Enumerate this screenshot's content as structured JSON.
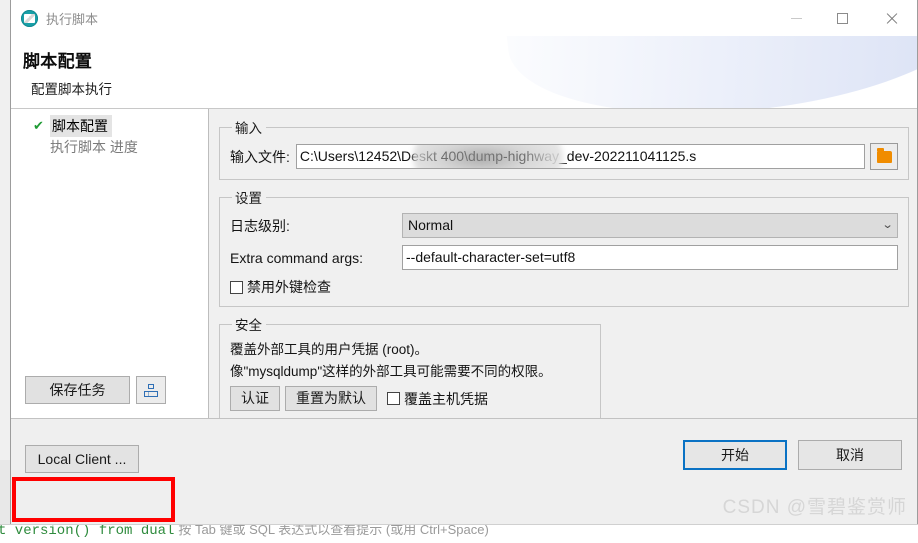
{
  "window": {
    "title": "执行脚本",
    "icon": "app-icon",
    "controls": {
      "minimize": "minimize-icon",
      "maximize": "maximize-icon",
      "close": "close-icon"
    }
  },
  "header": {
    "title": "脚本配置",
    "subtitle": "配置脚本执行"
  },
  "sidebar": {
    "items": [
      {
        "label": "脚本配置",
        "check": "✔",
        "selected": true
      },
      {
        "label": "执行脚本 进度",
        "selected": false
      }
    ],
    "save_task_label": "保存任务",
    "save_icon": "save-disk-icon"
  },
  "input_group": {
    "legend": "输入",
    "file_label": "输入文件:",
    "file_value": "C:\\Users\\12452\\Deskt                    400\\dump-highway_dev-202211041125.s",
    "browse_icon": "folder-icon"
  },
  "settings_group": {
    "legend": "设置",
    "log_level_label": "日志级别:",
    "log_level_value": "Normal",
    "log_level_chevron": "⌄",
    "extra_args_label": "Extra command args:",
    "extra_args_value": "--default-character-set=utf8",
    "disable_fk_label": "禁用外键检查",
    "disable_fk_checked": false
  },
  "security_group": {
    "legend": "安全",
    "line1": "覆盖外部工具的用户凭据 (root)。",
    "line2": "像\"mysqldump\"这样的外部工具可能需要不同的权限。",
    "auth_button": "认证",
    "reset_button": "重置为默认",
    "override_host_label": "覆盖主机凭据",
    "override_host_checked": false
  },
  "footer": {
    "local_client_label": "Local Client ...",
    "start_label": "开始",
    "cancel_label": "取消",
    "watermark": "CSDN @雪碧鉴赏师"
  },
  "background": {
    "sql_green": "t version() from dual",
    "sql_gray": "按 Tab 键或 SQL 表达式以查看提示 (或用 Ctrl+Space)"
  },
  "colors": {
    "accent_blue": "#0a72c4",
    "folder_orange": "#f08c00",
    "annotation_red": "#ff0000",
    "check_green": "#1f9b34",
    "title_icon_teal": "#19a0a8"
  }
}
